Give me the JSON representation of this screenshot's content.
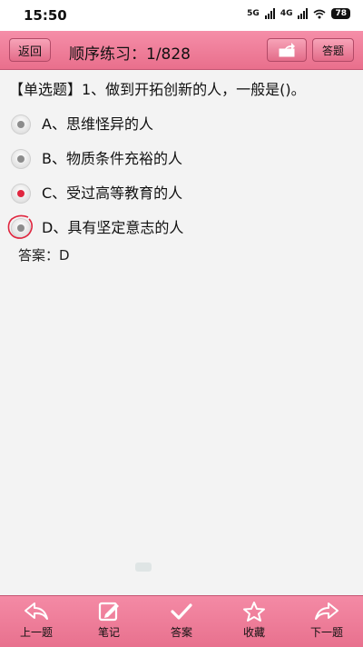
{
  "status_bar": {
    "time": "15:50",
    "network1": "5G",
    "network2": "4G",
    "battery": "78"
  },
  "header": {
    "back_label": "返回",
    "title": "顺序练习：1/828",
    "answer_label": "答题"
  },
  "question": {
    "text": "【单选题】1、做到开拓创新的人，一般是()。",
    "options": [
      {
        "text": "A、思维怪异的人",
        "selected": false
      },
      {
        "text": "B、物质条件充裕的人",
        "selected": false
      },
      {
        "text": "C、受过高等教育的人",
        "selected": true
      },
      {
        "text": "D、具有坚定意志的人",
        "selected": false,
        "correct_marked": true
      }
    ],
    "answer": "答案：D"
  },
  "colors": {
    "header": "#ee7f9b",
    "selected_dot": "#e0263f",
    "correct_circle": "#e0263f"
  },
  "bottom_bar": {
    "items": [
      {
        "label": "上一题",
        "icon": "prev-arrow-icon"
      },
      {
        "label": "笔记",
        "icon": "edit-note-icon"
      },
      {
        "label": "答案",
        "icon": "check-icon"
      },
      {
        "label": "收藏",
        "icon": "star-icon"
      },
      {
        "label": "下一题",
        "icon": "next-arrow-icon"
      }
    ]
  }
}
